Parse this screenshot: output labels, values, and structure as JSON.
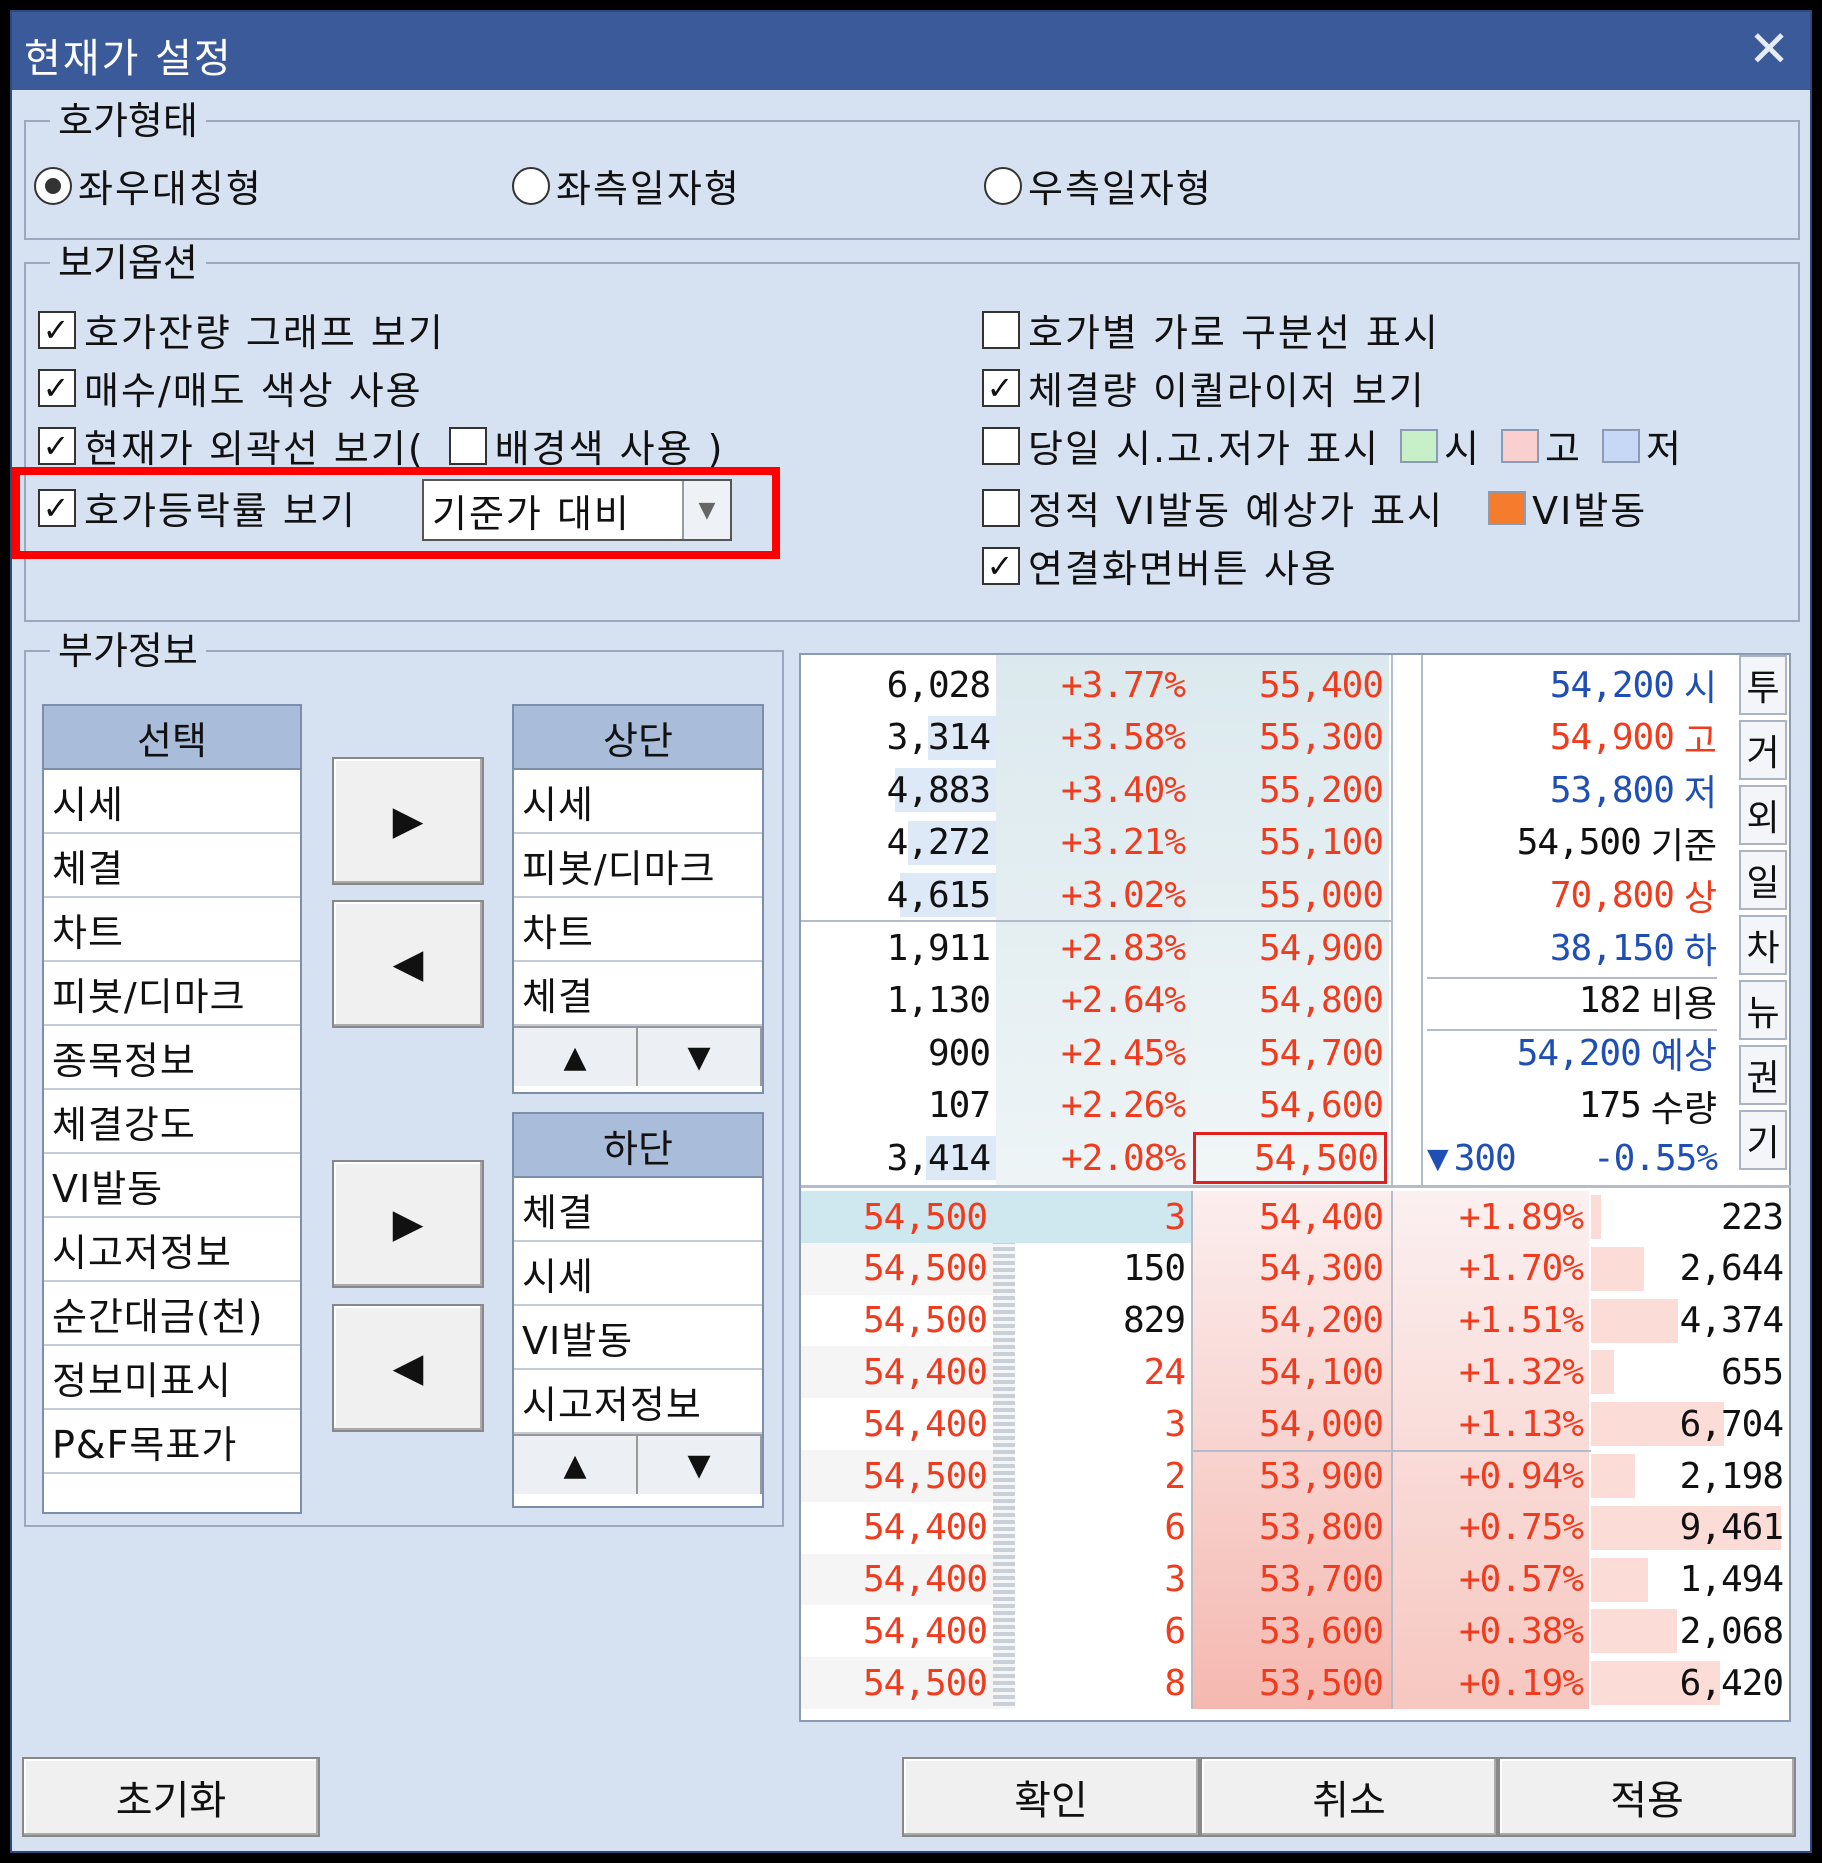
{
  "window": {
    "title": "현재가 설정",
    "close": "✕"
  },
  "hoga_type": {
    "legend": "호가형태",
    "options": [
      "좌우대칭형",
      "좌측일자형",
      "우측일자형"
    ],
    "selected": 0
  },
  "view_options": {
    "legend": "보기옵션",
    "left": [
      {
        "label": "호가잔량 그래프 보기",
        "checked": true
      },
      {
        "label": "매수/매도 색상 사용",
        "checked": true
      },
      {
        "label": "현재가 외곽선 보기(",
        "checked": true
      },
      {
        "label": "호가등락률 보기",
        "checked": true
      }
    ],
    "bg_color_label": "배경색 사용 )",
    "bg_color_checked": false,
    "rate_combo_value": "기준가 대비",
    "right": [
      {
        "label": "호가별 가로 구분선 표시",
        "checked": false
      },
      {
        "label": "체결량 이퀄라이저 보기",
        "checked": true
      },
      {
        "label": "당일 시.고.저가 표시",
        "checked": false
      },
      {
        "label": "정적 VI발동 예상가 표시",
        "checked": false
      },
      {
        "label": "연결화면버튼 사용",
        "checked": true
      }
    ],
    "swatches": [
      {
        "label": "시",
        "color": "#c8f0c8"
      },
      {
        "label": "고",
        "color": "#f9cfcf"
      },
      {
        "label": "저",
        "color": "#c6d8f6"
      }
    ],
    "vi_swatch": {
      "label": "VI발동",
      "color": "#f47c2c"
    }
  },
  "extra_info": {
    "legend": "부가정보",
    "select_header": "선택",
    "select_items": [
      "시세",
      "체결",
      "차트",
      "피봇/디마크",
      "종목정보",
      "체결강도",
      "VI발동",
      "시고저정보",
      "순간대금(천)",
      "정보미표시",
      "P&F목표가"
    ],
    "top_header": "상단",
    "top_items": [
      "시세",
      "피봇/디마크",
      "차트",
      "체결"
    ],
    "bottom_header": "하단",
    "bottom_items": [
      "체결",
      "시세",
      "VI발동",
      "시고저정보"
    ],
    "move_right": "▶",
    "move_left": "◀",
    "up": "▲",
    "down": "▼"
  },
  "preview": {
    "ask_rows": [
      {
        "qty": "6,028",
        "rate": "+3.77%",
        "price": "55,400",
        "bar": 0.0
      },
      {
        "qty": "3,314",
        "rate": "+3.58%",
        "price": "55,300",
        "bar": 0.35
      },
      {
        "qty": "4,883",
        "rate": "+3.40%",
        "price": "55,200",
        "bar": 0.52
      },
      {
        "qty": "4,272",
        "rate": "+3.21%",
        "price": "55,100",
        "bar": 0.45
      },
      {
        "qty": "4,615",
        "rate": "+3.02%",
        "price": "55,000",
        "bar": 0.49
      },
      {
        "qty": "1,911",
        "rate": "+2.83%",
        "price": "54,900",
        "bar": 0.0
      },
      {
        "qty": "1,130",
        "rate": "+2.64%",
        "price": "54,800",
        "bar": 0.0
      },
      {
        "qty": "900",
        "rate": "+2.45%",
        "price": "54,700",
        "bar": 0.0
      },
      {
        "qty": "107",
        "rate": "+2.26%",
        "price": "54,600",
        "bar": 0.0
      },
      {
        "qty": "3,414",
        "rate": "+2.08%",
        "price": "54,500",
        "bar": 0.36
      }
    ],
    "side_info": [
      {
        "value": "54,200",
        "label": "시",
        "color": "blue"
      },
      {
        "value": "54,900",
        "label": "고",
        "color": "red"
      },
      {
        "value": "53,800",
        "label": "저",
        "color": "blue"
      },
      {
        "value": "54,500",
        "label": "기준",
        "color": "dark"
      },
      {
        "value": "70,800",
        "label": "상",
        "color": "red"
      },
      {
        "value": "38,150",
        "label": "하",
        "color": "blue"
      },
      {
        "value": "182",
        "label": "비용",
        "color": "dark"
      },
      {
        "value": "54,200",
        "label": "예상",
        "color": "blue"
      },
      {
        "value": "175",
        "label": "수량",
        "color": "dark"
      }
    ],
    "change": {
      "arrow": "▼",
      "amount": "300",
      "rate": "-0.55%"
    },
    "side_tabs": [
      "투",
      "거",
      "외",
      "일",
      "차",
      "뉴",
      "권",
      "기"
    ],
    "bid_rows": [
      {
        "exec_price": "54,500",
        "exec_qty": "3",
        "price": "54,400",
        "rate": "+1.89%",
        "qty": "223",
        "bar": 0.05
      },
      {
        "exec_price": "54,500",
        "exec_qty": "150",
        "price": "54,300",
        "rate": "+1.70%",
        "qty": "2,644",
        "bar": 0.28
      },
      {
        "exec_price": "54,500",
        "exec_qty": "829",
        "price": "54,200",
        "rate": "+1.51%",
        "qty": "4,374",
        "bar": 0.46
      },
      {
        "exec_price": "54,400",
        "exec_qty": "24",
        "price": "54,100",
        "rate": "+1.32%",
        "qty": "655",
        "bar": 0.12
      },
      {
        "exec_price": "54,400",
        "exec_qty": "3",
        "price": "54,000",
        "rate": "+1.13%",
        "qty": "6,704",
        "bar": 0.7
      },
      {
        "exec_price": "54,500",
        "exec_qty": "2",
        "price": "53,900",
        "rate": "+0.94%",
        "qty": "2,198",
        "bar": 0.23
      },
      {
        "exec_price": "54,400",
        "exec_qty": "6",
        "price": "53,800",
        "rate": "+0.75%",
        "qty": "9,461",
        "bar": 1.0
      },
      {
        "exec_price": "54,400",
        "exec_qty": "3",
        "price": "53,700",
        "rate": "+0.57%",
        "qty": "1,494",
        "bar": 0.3
      },
      {
        "exec_price": "54,400",
        "exec_qty": "6",
        "price": "53,600",
        "rate": "+0.38%",
        "qty": "2,068",
        "bar": 0.45
      },
      {
        "exec_price": "54,500",
        "exec_qty": "8",
        "price": "53,500",
        "rate": "+0.19%",
        "qty": "6,420",
        "bar": 0.68
      }
    ]
  },
  "buttons": {
    "reset": "초기화",
    "ok": "확인",
    "cancel": "취소",
    "apply": "적용"
  }
}
